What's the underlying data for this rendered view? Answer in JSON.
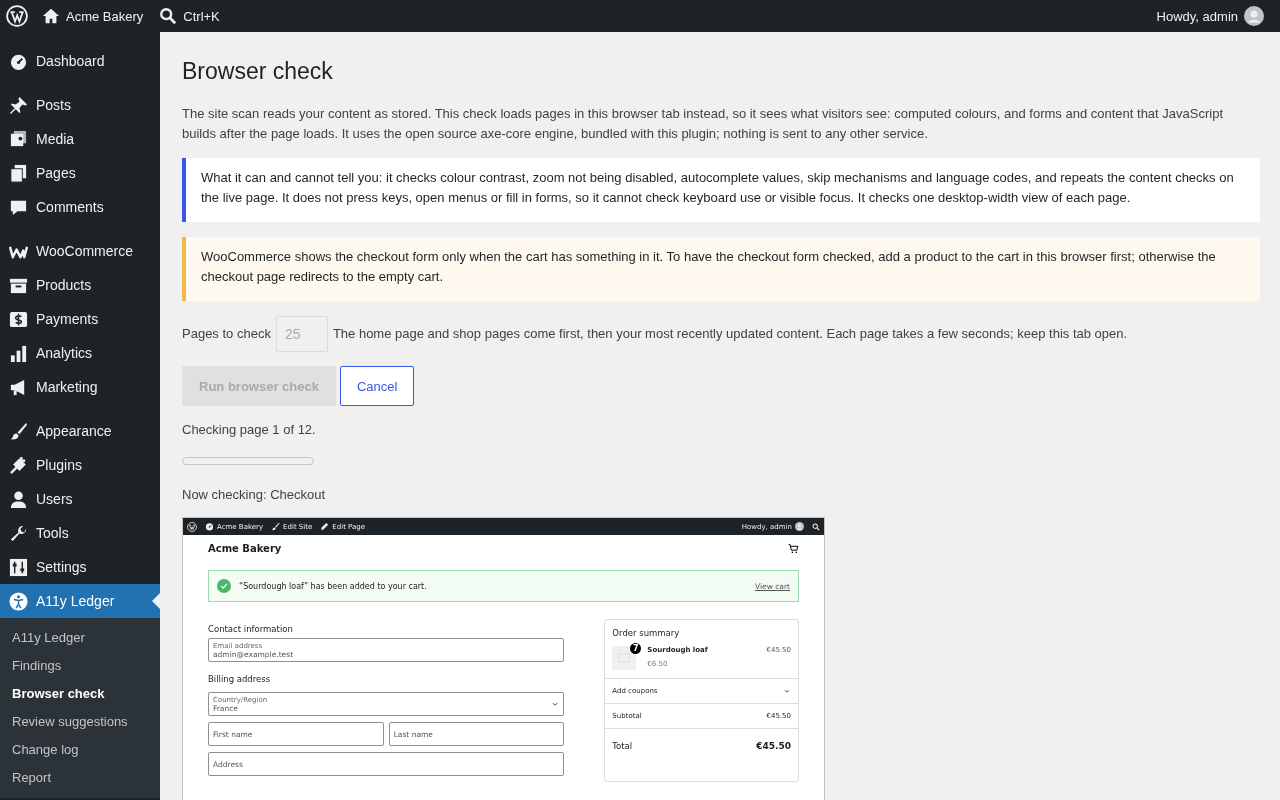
{
  "admin_bar": {
    "site_name": "Acme Bakery",
    "search_shortcut": "Ctrl+K",
    "greeting": "Howdy, admin"
  },
  "sidebar": {
    "groups": [
      {
        "items": [
          {
            "label": "Dashboard",
            "selected": false
          }
        ]
      },
      {
        "items": [
          {
            "label": "Posts",
            "selected": false
          },
          {
            "label": "Media",
            "selected": false
          },
          {
            "label": "Pages",
            "selected": false
          },
          {
            "label": "Comments",
            "selected": false
          }
        ]
      },
      {
        "items": [
          {
            "label": "WooCommerce",
            "selected": false
          },
          {
            "label": "Products",
            "selected": false
          },
          {
            "label": "Payments",
            "selected": false
          },
          {
            "label": "Analytics",
            "selected": false
          },
          {
            "label": "Marketing",
            "selected": false
          }
        ]
      },
      {
        "items": [
          {
            "label": "Appearance",
            "selected": false
          },
          {
            "label": "Plugins",
            "selected": false
          },
          {
            "label": "Users",
            "selected": false
          },
          {
            "label": "Tools",
            "selected": false
          },
          {
            "label": "Settings",
            "selected": false
          },
          {
            "label": "A11y Ledger",
            "selected": true,
            "children": [
              {
                "label": "A11y Ledger",
                "selected": false
              },
              {
                "label": "Findings",
                "selected": false
              },
              {
                "label": "Browser check",
                "selected": true
              },
              {
                "label": "Review suggestions",
                "selected": false
              },
              {
                "label": "Change log",
                "selected": false
              },
              {
                "label": "Report",
                "selected": false
              }
            ]
          }
        ]
      }
    ]
  },
  "main": {
    "title": "Browser check",
    "intro": "The site scan reads your content as stored. This check loads pages in this browser tab instead, so it sees what visitors see: computed colours, and forms and content that JavaScript builds after the page loads. It uses the open source axe-core engine, bundled with this plugin; nothing is sent to any other service.",
    "notices": [
      {
        "kind": "info",
        "text": "What it can and cannot tell you: it checks colour contrast, zoom not being disabled, autocomplete values, skip mechanisms and language codes, and repeats the content checks on the live page. It does not press keys, open menus or fill in forms, so it cannot check keyboard use or visible focus. It checks one desktop-width view of each page."
      },
      {
        "kind": "warning",
        "text": "WooCommerce shows the checkout form only when the cart has something in it. To have the checkout form checked, add a product to the cart in this browser first; otherwise the checkout page redirects to the empty cart."
      }
    ],
    "pages_label": "Pages to check",
    "pages_placeholder": "25",
    "pages_disabled": true,
    "pages_help": "The home page and shop pages come first, then your most recently updated content. Each page takes a few seconds; keep this tab open.",
    "buttons": [
      {
        "label": "Run browser check",
        "kind": "primary",
        "disabled": true
      },
      {
        "label": "Cancel",
        "kind": "secondary",
        "disabled": false
      }
    ],
    "status": "Checking page 1 of 12.",
    "progress": {
      "level": 0
    },
    "now_checking": "Now checking: Checkout"
  },
  "preview": {
    "bar": {
      "site_name": "Acme Bakery",
      "links": [
        "Edit Site",
        "Edit Page"
      ],
      "greeting": "Howdy, admin"
    },
    "site_title": "Acme Bakery",
    "notice": {
      "text": "“Sourdough loaf” has been added to your cart.",
      "link": "View cart"
    },
    "contact_heading": "Contact information",
    "email": {
      "label": "Email address",
      "value": "admin@example.test"
    },
    "billing_heading": "Billing address",
    "country": {
      "label": "Country/Region",
      "value": "France"
    },
    "name_fields": [
      {
        "placeholder": "First name"
      },
      {
        "placeholder": "Last name"
      }
    ],
    "address": {
      "placeholder": "Address"
    },
    "summary": {
      "heading": "Order summary",
      "item_name": "Sourdough loaf",
      "quantity": "7",
      "item_total": "€45.50",
      "unit_price": "€6.50",
      "coupons": "Add coupons",
      "subtotal_label": "Subtotal",
      "subtotal": "€45.50",
      "total_label": "Total",
      "total": "€45.50"
    }
  }
}
